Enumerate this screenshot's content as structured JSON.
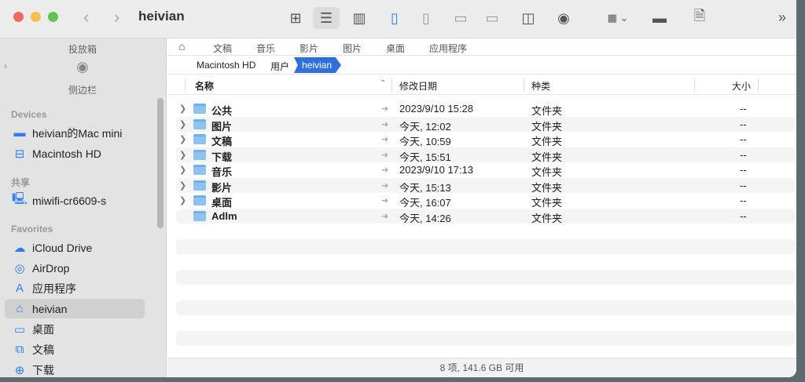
{
  "window": {
    "title": "heivian"
  },
  "toolbar": {
    "back": "‹",
    "forward": "›",
    "more": "»",
    "buttons": [
      "view-icons",
      "view-list",
      "view-columns",
      "sidebar-toggle",
      "inspector-toggle",
      "preview-bottom",
      "pathbar-toggle",
      "split-view",
      "quick-look",
      "group-by",
      "ruler",
      "search-document"
    ]
  },
  "sidebar": {
    "dropbox_top": "投放箱",
    "dropbox_bottom": "侧边栏",
    "sections": {
      "devices": "Devices",
      "shared": "共享",
      "favorites": "Favorites"
    },
    "devices": [
      {
        "label": "heivian的Mac mini",
        "icon": "display-icon"
      },
      {
        "label": "Macintosh HD",
        "icon": "drive-icon"
      }
    ],
    "shared": [
      {
        "label": "miwifi-cr6609-s",
        "icon": "network-computer-icon"
      }
    ],
    "favorites": [
      {
        "label": "iCloud Drive",
        "icon": "cloud-icon"
      },
      {
        "label": "AirDrop",
        "icon": "airdrop-icon"
      },
      {
        "label": "应用程序",
        "icon": "apps-icon"
      },
      {
        "label": "heivian",
        "icon": "home-icon",
        "selected": true
      },
      {
        "label": "桌面",
        "icon": "desktop-icon"
      },
      {
        "label": "文稿",
        "icon": "documents-icon"
      },
      {
        "label": "下载",
        "icon": "download-icon"
      }
    ]
  },
  "favbar": [
    "文稿",
    "音乐",
    "影片",
    "图片",
    "桌面",
    "应用程序"
  ],
  "pathbar": [
    "Macintosh HD",
    "用户",
    "heivian"
  ],
  "columns": {
    "name": "名称",
    "date": "修改日期",
    "kind": "种类",
    "size": "大小"
  },
  "files": [
    {
      "name": "公共",
      "date": "2023/9/10 15:28",
      "kind": "文件夹",
      "size": "--",
      "expandable": true
    },
    {
      "name": "图片",
      "date": "今天, 12:02",
      "kind": "文件夹",
      "size": "--",
      "expandable": true
    },
    {
      "name": "文稿",
      "date": "今天, 10:59",
      "kind": "文件夹",
      "size": "--",
      "expandable": true
    },
    {
      "name": "下载",
      "date": "今天, 15:51",
      "kind": "文件夹",
      "size": "--",
      "expandable": true
    },
    {
      "name": "音乐",
      "date": "2023/9/10 17:13",
      "kind": "文件夹",
      "size": "--",
      "expandable": true
    },
    {
      "name": "影片",
      "date": "今天, 15:13",
      "kind": "文件夹",
      "size": "--",
      "expandable": true
    },
    {
      "name": "桌面",
      "date": "今天, 16:07",
      "kind": "文件夹",
      "size": "--",
      "expandable": true
    },
    {
      "name": "Adlm",
      "date": "今天, 14:26",
      "kind": "文件夹",
      "size": "--",
      "expandable": false
    }
  ],
  "status": "8 项, 141.6 GB 可用",
  "colors": {
    "accent": "#2f6fdc",
    "close": "#ec6a5e",
    "minimize": "#f4bf4f",
    "zoom": "#61c554"
  }
}
